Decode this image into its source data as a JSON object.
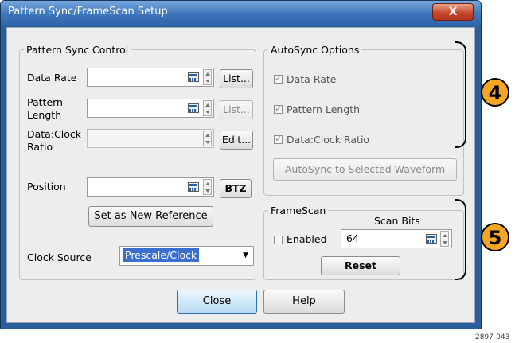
{
  "window": {
    "title": "Pattern Sync/FrameScan Setup",
    "close_glyph": "X"
  },
  "pattern_sync": {
    "legend": "Pattern Sync Control",
    "data_rate_label": "Data Rate",
    "data_rate_value": "",
    "data_rate_list": "List...",
    "pattern_length_label": "Pattern\nLength",
    "pattern_length_value": "",
    "pattern_length_list": "List...",
    "clock_ratio_label": "Data:Clock\nRatio",
    "clock_ratio_value": "",
    "clock_ratio_edit": "Edit...",
    "position_label": "Position",
    "position_value": "",
    "btz": "BTZ",
    "set_reference": "Set as New Reference",
    "clock_source_label": "Clock Source",
    "clock_source_value": "Prescale/Clock"
  },
  "autosync": {
    "legend": "AutoSync Options",
    "options": [
      {
        "label": "Data Rate",
        "checked": true
      },
      {
        "label": "Pattern Length",
        "checked": true
      },
      {
        "label": "Data:Clock Ratio",
        "checked": true
      }
    ],
    "button": "AutoSync to Selected Waveform"
  },
  "framescan": {
    "legend": "FrameScan",
    "scan_bits_label": "Scan Bits",
    "enabled_label": "Enabled",
    "enabled_checked": false,
    "scan_bits_value": "64",
    "reset": "Reset"
  },
  "footer": {
    "close": "Close",
    "help": "Help"
  },
  "callouts": {
    "a": "4",
    "b": "5"
  },
  "figure_id": "2897-043",
  "colors": {
    "callout": "#f5a623",
    "titlebar": "#3f77bd",
    "selection": "#3a6fd0"
  }
}
